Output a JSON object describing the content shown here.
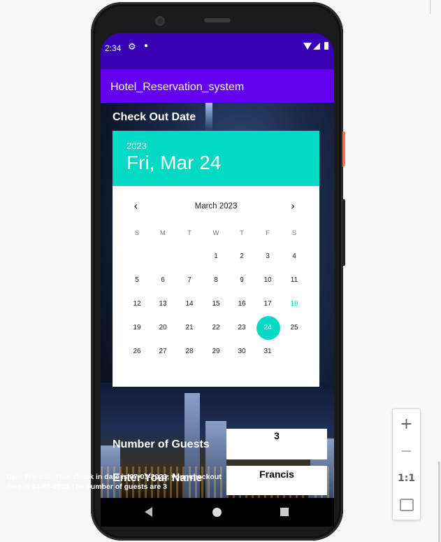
{
  "status_bar": {
    "time": "2:34"
  },
  "app_bar": {
    "title": "Hotel_Reservation_system"
  },
  "checkout": {
    "label": "Check Out Date"
  },
  "picker": {
    "year": "2023",
    "date": "Fri, Mar 24",
    "month": "March 2023",
    "weekdays": [
      "S",
      "M",
      "T",
      "W",
      "T",
      "F",
      "S"
    ],
    "days": [
      "1",
      "2",
      "3",
      "4",
      "5",
      "6",
      "7",
      "8",
      "9",
      "10",
      "11",
      "12",
      "13",
      "14",
      "15",
      "16",
      "17",
      "18",
      "19",
      "20",
      "21",
      "22",
      "23",
      "24",
      "25",
      "26",
      "27",
      "28",
      "29",
      "30",
      "31"
    ],
    "today": "18",
    "selected": "24"
  },
  "guests": {
    "label": "Number of Guests",
    "value": "3"
  },
  "name": {
    "label": "Enter Your Name",
    "value": "Francis"
  },
  "summary": "Dear Francis, Your check in date is 07-03-2023, your checkout date is 24-03-2023.The number of guests are 3",
  "emulator": {
    "zoom_in": "+",
    "zoom_out": "−",
    "one_to_one": "1:1"
  }
}
